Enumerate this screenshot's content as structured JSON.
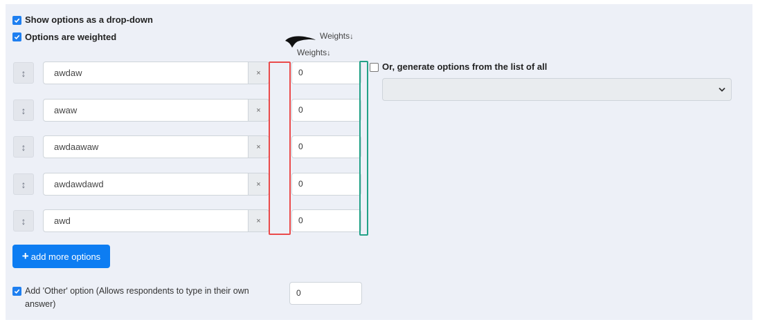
{
  "settings": {
    "show_dropdown_label": "Show options as a drop-down",
    "weighted_label": "Options are weighted",
    "weights_header": "Weights",
    "weights_annotation": "Weights",
    "sort_glyph": "↓"
  },
  "options": [
    {
      "text": "awdaw",
      "weight": "0"
    },
    {
      "text": "awaw",
      "weight": "0"
    },
    {
      "text": "awdaawaw",
      "weight": "0"
    },
    {
      "text": "awdawdawd",
      "weight": "0"
    },
    {
      "text": "awd",
      "weight": "0"
    }
  ],
  "remove_glyph": "×",
  "drag_glyph": "↕",
  "add_button": {
    "icon": "+",
    "label": "add more options"
  },
  "generate": {
    "label": "Or, generate options from the list of all",
    "select_value": ""
  },
  "other_option": {
    "label_line1": "Add 'Other' option (Allows respondents to type in their own",
    "label_line2": "answer)",
    "weight": "0"
  },
  "colors": {
    "accent": "#1e7ff0",
    "highlight_red": "#ea4a4a",
    "highlight_green": "#22a187"
  },
  "icons": [
    "checkbox-icon",
    "drag-handle-icon",
    "remove-icon",
    "plus-icon",
    "chevron-down-icon",
    "pen-stroke-icon"
  ]
}
